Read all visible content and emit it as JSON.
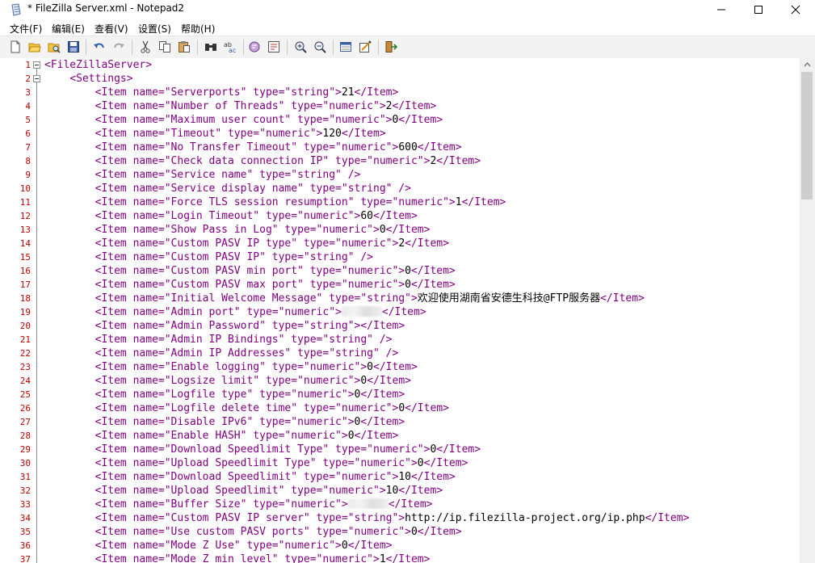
{
  "window": {
    "title": "* FileZilla Server.xml - Notepad2"
  },
  "menu": [
    "文件(F)",
    "编辑(E)",
    "查看(V)",
    "设置(S)",
    "帮助(H)"
  ],
  "toolbar": [
    "new-icon",
    "open-icon",
    "browse-icon",
    "save-icon",
    "undo-icon",
    "redo-icon",
    "cut-icon",
    "copy-icon",
    "paste-icon",
    "find-icon",
    "replace-icon",
    "wordwrap-icon",
    "view-icon",
    "zoom-in-icon",
    "zoom-out-icon",
    "scheme-icon",
    "settings-icon",
    "exit-icon"
  ],
  "colors": {
    "line_number": "#c00000",
    "xml_markup": "#800080",
    "text": "#000000"
  },
  "lines": [
    {
      "n": "1",
      "t": "<FileZillaServer>"
    },
    {
      "n": "2",
      "t": "    <Settings>"
    },
    {
      "n": "3",
      "t": "        <Item name=\"Serverports\" type=\"string\">21</Item>"
    },
    {
      "n": "4",
      "t": "        <Item name=\"Number of Threads\" type=\"numeric\">2</Item>"
    },
    {
      "n": "5",
      "t": "        <Item name=\"Maximum user count\" type=\"numeric\">0</Item>"
    },
    {
      "n": "6",
      "t": "        <Item name=\"Timeout\" type=\"numeric\">120</Item>"
    },
    {
      "n": "7",
      "t": "        <Item name=\"No Transfer Timeout\" type=\"numeric\">600</Item>"
    },
    {
      "n": "8",
      "t": "        <Item name=\"Check data connection IP\" type=\"numeric\">2</Item>"
    },
    {
      "n": "9",
      "t": "        <Item name=\"Service name\" type=\"string\" />"
    },
    {
      "n": "10",
      "t": "        <Item name=\"Service display name\" type=\"string\" />"
    },
    {
      "n": "11",
      "t": "        <Item name=\"Force TLS session resumption\" type=\"numeric\">1</Item>"
    },
    {
      "n": "12",
      "t": "        <Item name=\"Login Timeout\" type=\"numeric\">60</Item>"
    },
    {
      "n": "13",
      "t": "        <Item name=\"Show Pass in Log\" type=\"numeric\">0</Item>"
    },
    {
      "n": "14",
      "t": "        <Item name=\"Custom PASV IP type\" type=\"numeric\">2</Item>"
    },
    {
      "n": "15",
      "t": "        <Item name=\"Custom PASV IP\" type=\"string\" />"
    },
    {
      "n": "16",
      "t": "        <Item name=\"Custom PASV min port\" type=\"numeric\">0</Item>"
    },
    {
      "n": "17",
      "t": "        <Item name=\"Custom PASV max port\" type=\"numeric\">0</Item>"
    },
    {
      "n": "18",
      "t": "        <Item name=\"Initial Welcome Message\" type=\"string\">欢迎使用湖南省安德生科技@FTP服务器</Item>"
    },
    {
      "n": "19",
      "t": "        <Item name=\"Admin port\" type=\"numeric\">▒</Item>"
    },
    {
      "n": "20",
      "t": "        <Item name=\"Admin Password\" type=\"string\"></Item>"
    },
    {
      "n": "21",
      "t": "        <Item name=\"Admin IP Bindings\" type=\"string\" />"
    },
    {
      "n": "22",
      "t": "        <Item name=\"Admin IP Addresses\" type=\"string\" />"
    },
    {
      "n": "23",
      "t": "        <Item name=\"Enable logging\" type=\"numeric\">0</Item>"
    },
    {
      "n": "24",
      "t": "        <Item name=\"Logsize limit\" type=\"numeric\">0</Item>"
    },
    {
      "n": "25",
      "t": "        <Item name=\"Logfile type\" type=\"numeric\">0</Item>"
    },
    {
      "n": "26",
      "t": "        <Item name=\"Logfile delete time\" type=\"numeric\">0</Item>"
    },
    {
      "n": "27",
      "t": "        <Item name=\"Disable IPv6\" type=\"numeric\">0</Item>"
    },
    {
      "n": "28",
      "t": "        <Item name=\"Enable HASH\" type=\"numeric\">0</Item>"
    },
    {
      "n": "29",
      "t": "        <Item name=\"Download Speedlimit Type\" type=\"numeric\">0</Item>"
    },
    {
      "n": "30",
      "t": "        <Item name=\"Upload Speedlimit Type\" type=\"numeric\">0</Item>"
    },
    {
      "n": "31",
      "t": "        <Item name=\"Download Speedlimit\" type=\"numeric\">10</Item>"
    },
    {
      "n": "32",
      "t": "        <Item name=\"Upload Speedlimit\" type=\"numeric\">10</Item>"
    },
    {
      "n": "33",
      "t": "        <Item name=\"Buffer Size\" type=\"numeric\">▒</Item>"
    },
    {
      "n": "34",
      "t": "        <Item name=\"Custom PASV IP server\" type=\"string\">http://ip.filezilla-project.org/ip.php</Item>"
    },
    {
      "n": "35",
      "t": "        <Item name=\"Use custom PASV ports\" type=\"numeric\">0</Item>"
    },
    {
      "n": "36",
      "t": "        <Item name=\"Mode Z Use\" type=\"numeric\">0</Item>"
    },
    {
      "n": "37",
      "t": "        <Item name=\"Mode Z min level\" type=\"numeric\">1</Item>"
    }
  ]
}
